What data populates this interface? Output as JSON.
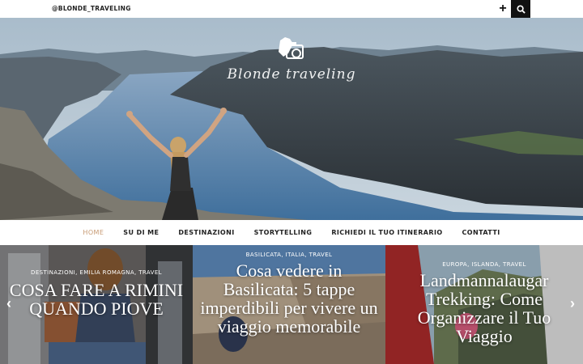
{
  "topbar": {
    "handle": "@BLONDE_TRAVELING",
    "plus_icon": "plus-icon",
    "search_icon": "search-icon"
  },
  "hero": {
    "logo_text": "Blonde traveling"
  },
  "nav": {
    "items": [
      {
        "label": "HOME",
        "active": true
      },
      {
        "label": "SU DI ME"
      },
      {
        "label": "DESTINAZIONI"
      },
      {
        "label": "STORYTELLING"
      },
      {
        "label": "RICHIEDI IL TUO ITINERARIO"
      },
      {
        "label": "CONTATTI"
      }
    ],
    "active_color": "#c79a73"
  },
  "slides": [
    {
      "categories": "DESTINAZIONI, EMILIA ROMAGNA, TRAVEL",
      "title": "COSA FARE A RIMINI QUANDO PIOVE"
    },
    {
      "categories": "BASILICATA, ITALIA, TRAVEL",
      "title": "Cosa vedere in Basilicata: 5 tappe imperdibili per vivere un viaggio memorabile"
    },
    {
      "categories": "EUROPA, ISLANDA, TRAVEL",
      "title": "Landmannalaugar Trekking: Come Organizzare il Tuo Viaggio"
    }
  ],
  "slider_arrows": {
    "prev": "‹",
    "next": "›"
  }
}
